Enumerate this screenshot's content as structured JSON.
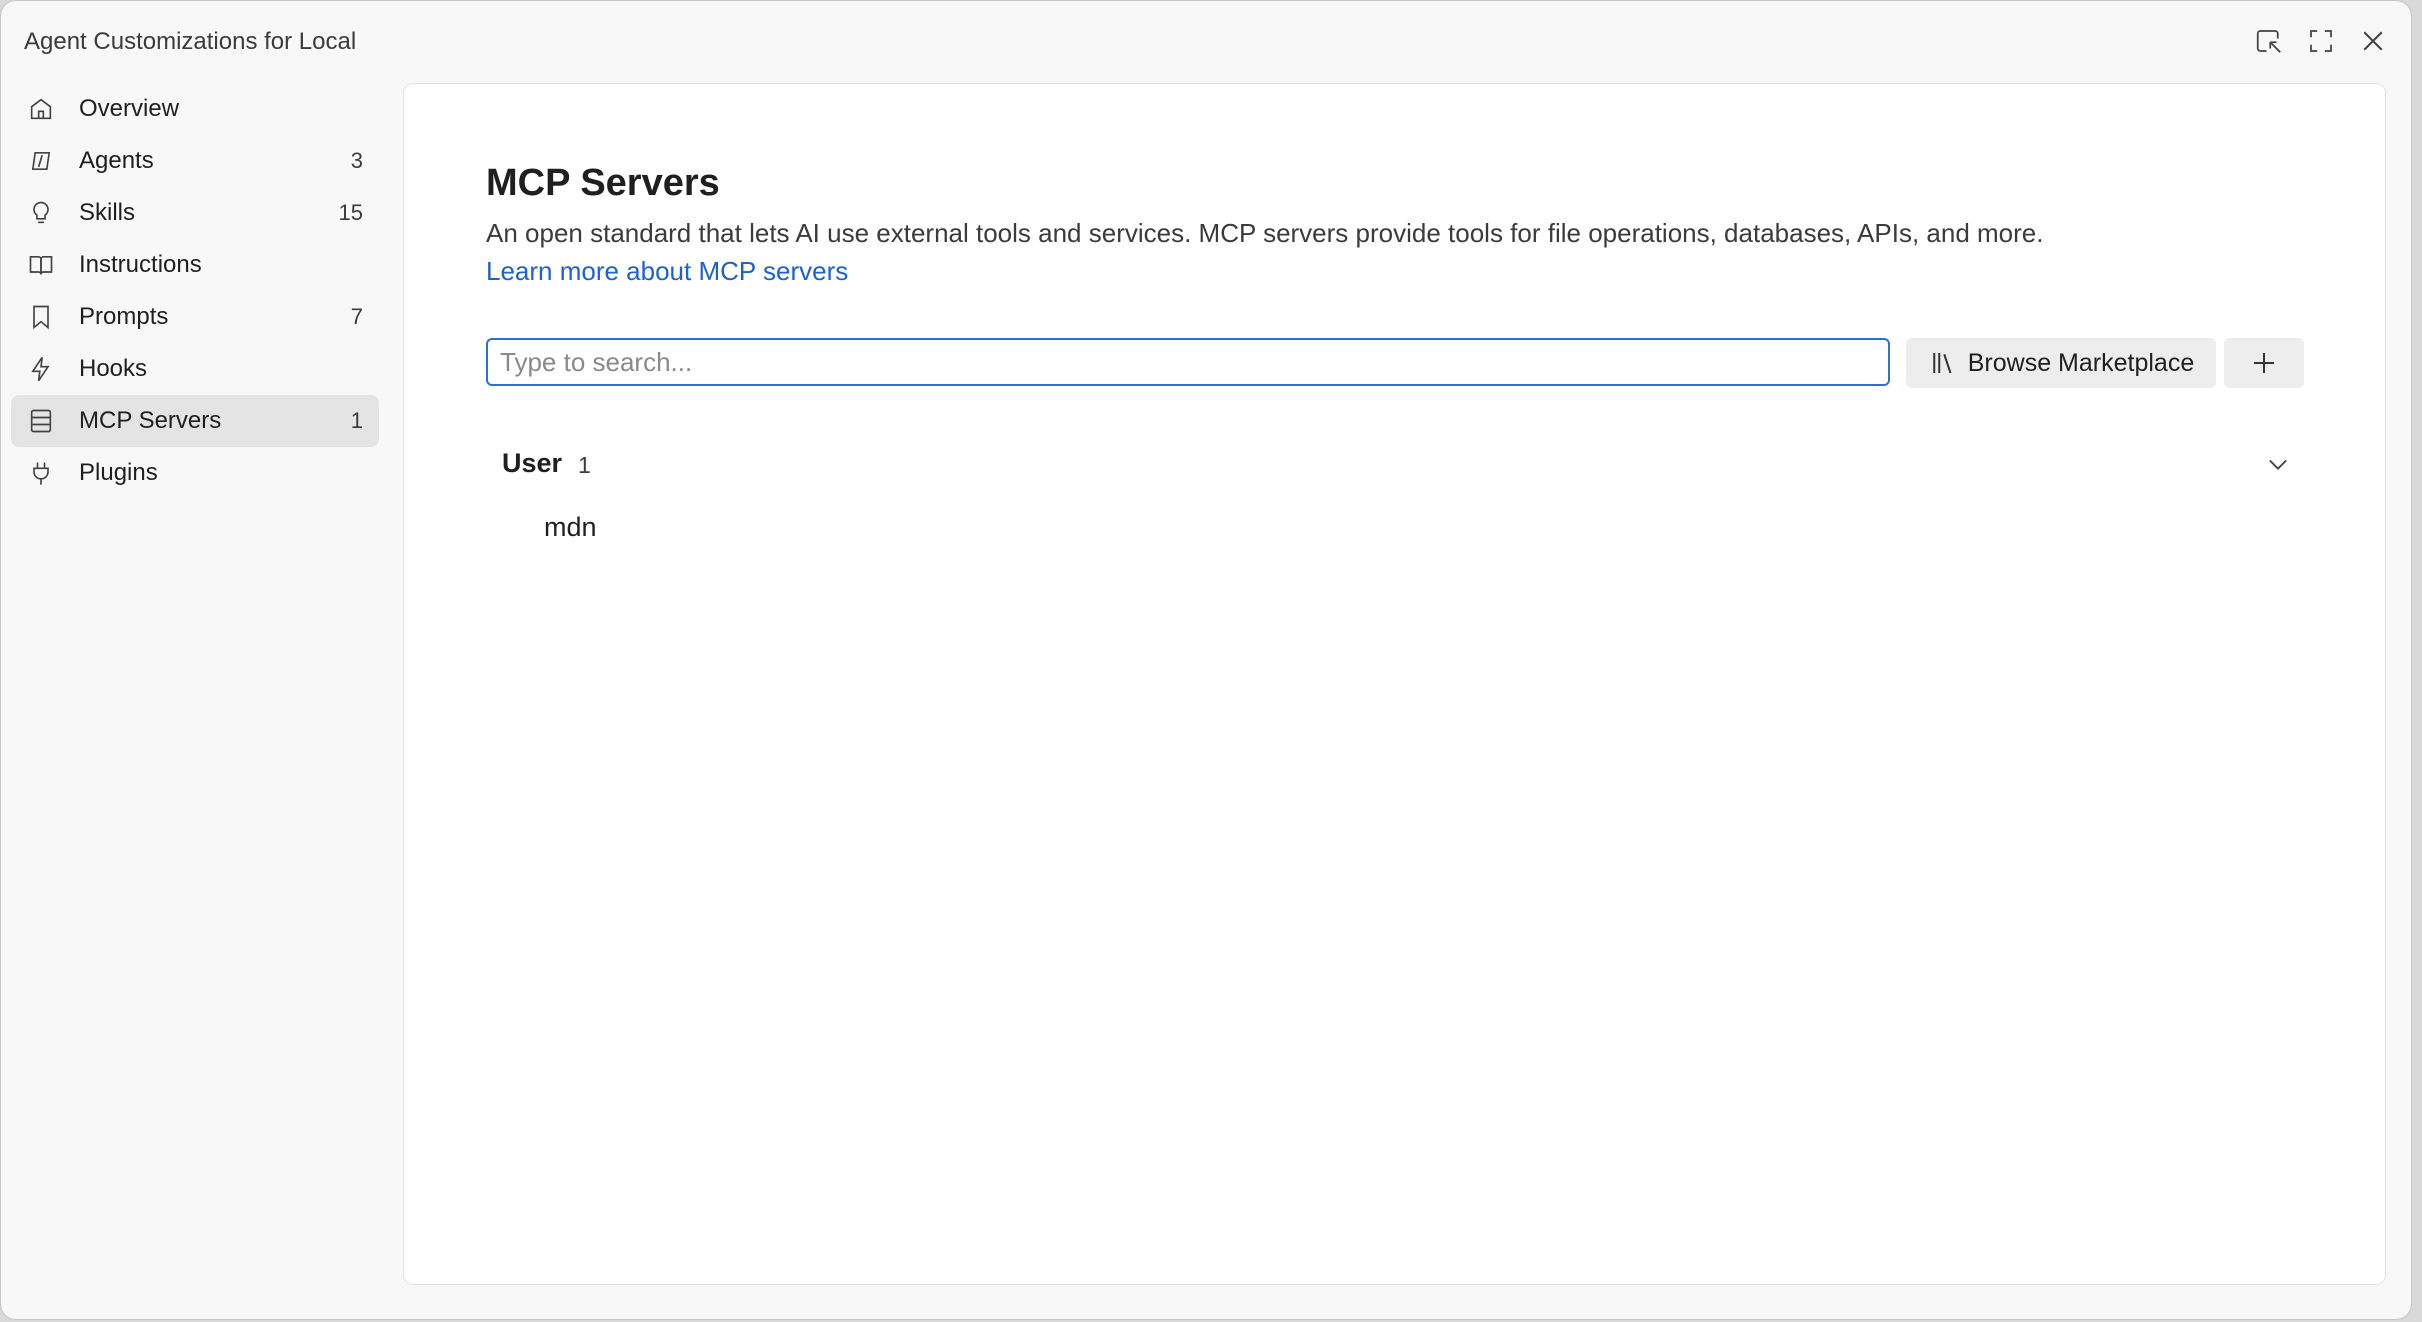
{
  "window": {
    "title": "Agent Customizations for Local"
  },
  "sidebar": {
    "items": [
      {
        "label": "Overview",
        "count": "",
        "icon": "home-icon"
      },
      {
        "label": "Agents",
        "count": "3",
        "icon": "agents-icon"
      },
      {
        "label": "Skills",
        "count": "15",
        "icon": "lightbulb-icon"
      },
      {
        "label": "Instructions",
        "count": "",
        "icon": "book-icon"
      },
      {
        "label": "Prompts",
        "count": "7",
        "icon": "bookmark-icon"
      },
      {
        "label": "Hooks",
        "count": "",
        "icon": "lightning-icon"
      },
      {
        "label": "MCP Servers",
        "count": "1",
        "icon": "server-icon"
      },
      {
        "label": "Plugins",
        "count": "",
        "icon": "plug-icon"
      }
    ],
    "active": "MCP Servers"
  },
  "main": {
    "title": "MCP Servers",
    "description": "An open standard that lets AI use external tools and services. MCP servers provide tools for file operations, databases, APIs, and more.",
    "learn_more": "Learn more about MCP servers",
    "search": {
      "placeholder": "Type to search...",
      "value": ""
    },
    "browse_label": "Browse Marketplace",
    "groups": [
      {
        "name": "User",
        "count": "1",
        "items": [
          "mdn"
        ]
      }
    ]
  },
  "colors": {
    "accent": "#2f6fd1",
    "link": "#1d63c8",
    "active_bg": "#e4e4e4"
  }
}
